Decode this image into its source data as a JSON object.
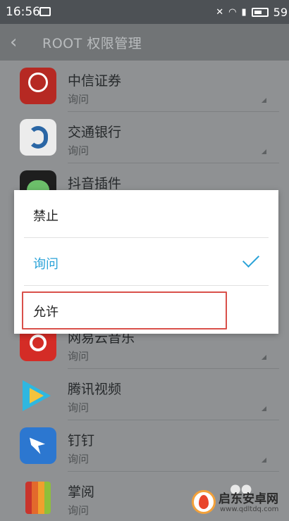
{
  "status_bar": {
    "time": "16:56",
    "battery_text": "59",
    "icons": [
      "image-icon",
      "mute-icon",
      "wifi-icon",
      "signal-4g-icon",
      "battery-icon"
    ]
  },
  "app_bar": {
    "back_icon": "back-chevron-icon",
    "title": "ROOT 权限管理"
  },
  "apps": [
    {
      "name": "中信证券",
      "permission": "询问",
      "icon": "citic-securities-icon"
    },
    {
      "name": "交通银行",
      "permission": "询问",
      "icon": "bocom-icon"
    },
    {
      "name": "抖音插件",
      "permission": "",
      "icon": "douyin-plugin-icon"
    },
    {
      "name": "网易云音乐",
      "permission": "询问",
      "icon": "netease-music-icon"
    },
    {
      "name": "腾讯视频",
      "permission": "询问",
      "icon": "tencent-video-icon"
    },
    {
      "name": "钉钉",
      "permission": "询问",
      "icon": "dingtalk-icon"
    },
    {
      "name": "掌阅",
      "permission": "询问",
      "icon": "zhangyue-icon"
    }
  ],
  "dialog": {
    "options": [
      {
        "label": "禁止",
        "selected": false
      },
      {
        "label": "询问",
        "selected": true
      },
      {
        "label": "允许",
        "selected": false,
        "highlighted": true
      }
    ]
  },
  "watermark": {
    "title": "启东安卓网",
    "url": "www.qdltdq.com"
  },
  "colors": {
    "accent": "#2ba3d8",
    "highlight_border": "#d9504a"
  }
}
